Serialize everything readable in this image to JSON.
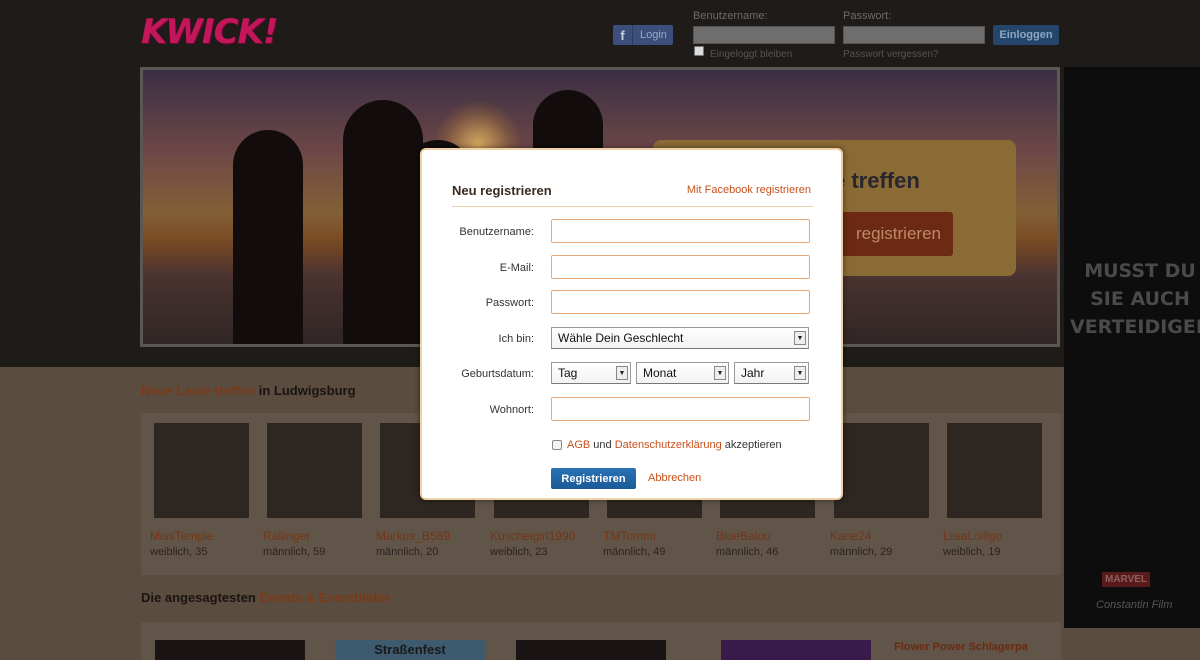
{
  "header": {
    "logo_text": "KWICK!",
    "fb_login_label": "Login",
    "username_label": "Benutzername:",
    "password_label": "Passwort:",
    "remember_label": "Eingeloggt bleiben",
    "forgot_label": "Passwort vergessen?",
    "login_button": "Einloggen"
  },
  "banner": {
    "headline_fragment": "e treffen",
    "button_fragment": "registrieren"
  },
  "side_ad": {
    "headline": "MUSST DU SIE AUCH VERTEIDIGEN",
    "brand1": "MARVEL",
    "brand2": "Constantin Film"
  },
  "people_section": {
    "title_highlight": "Neue Leute treffen",
    "title_rest": " in Ludwigsburg",
    "people": [
      {
        "name": "MissTemple",
        "info": "weiblich, 35"
      },
      {
        "name": "Rallinger",
        "info": "männlich, 59"
      },
      {
        "name": "Markus_B589",
        "info": "männlich, 20"
      },
      {
        "name": "Kuschelgirl1990",
        "info": "weiblich, 23"
      },
      {
        "name": "TMTommi",
        "info": "männlich, 49"
      },
      {
        "name": "BlueBalou",
        "info": "männlich, 46"
      },
      {
        "name": "Kane24",
        "info": "männlich, 29"
      },
      {
        "name": "LiisaLolligo",
        "info": "weiblich, 19"
      }
    ]
  },
  "events_section": {
    "title_start": "Die angesagtesten ",
    "title_highlight": "Events & Eventbilder",
    "event_a": "Straßenfest",
    "event_b": "Flower Power Schlagerpa"
  },
  "modal": {
    "title": "Neu registrieren",
    "facebook_link": "Mit Facebook registrieren",
    "username_label": "Benutzername:",
    "email_label": "E-Mail:",
    "password_label": "Passwort:",
    "gender_label": "Ich bin:",
    "gender_value": "Wähle Dein Geschlecht",
    "birthdate_label": "Geburtsdatum:",
    "day_value": "Tag",
    "month_value": "Monat",
    "year_value": "Jahr",
    "city_label": "Wohnort:",
    "agb_link": "AGB",
    "and_text": " und ",
    "privacy_link": "Datenschutzerklärung",
    "accept_text": " akzeptieren",
    "register_button": "Registrieren",
    "cancel_link": "Abbrechen"
  },
  "colors": {
    "accent": "#c8501a",
    "primary_button": "#1a5a98",
    "logo": "#c4175b"
  }
}
